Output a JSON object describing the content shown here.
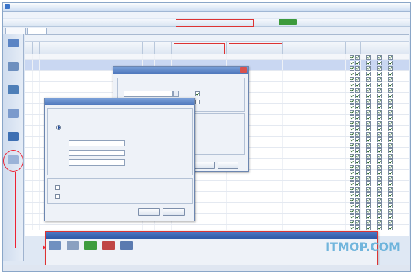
{
  "watermark": {
    "text": "ITMOP.COM"
  }
}
